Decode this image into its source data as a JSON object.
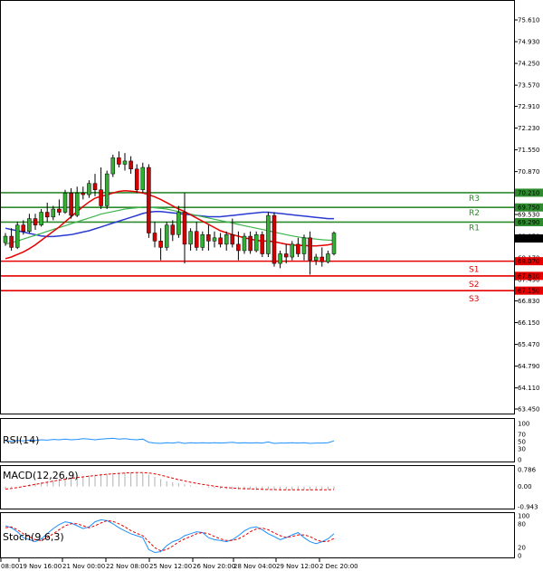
{
  "chart_data": [
    {
      "type": "candlestick",
      "ylim": [
        63.45,
        76.1
      ],
      "yticks": [
        "75.610",
        "74.930",
        "74.250",
        "73.570",
        "72.910",
        "72.230",
        "71.550",
        "70.870",
        "70.190",
        "69.530",
        "68.850",
        "68.170",
        "67.490",
        "66.830",
        "66.150",
        "65.470",
        "64.790",
        "64.110",
        "63.450"
      ],
      "xticks": [
        "08:00",
        "19 Nov 16:00",
        "21 Nov 00:00",
        "22 Nov 08:00",
        "25 Nov 12:00",
        "26 Nov 20:00",
        "28 Nov 04:00",
        "29 Nov 12:00",
        "2 Dec 20:00"
      ],
      "levels": [
        {
          "name": "R3",
          "value": 70.21,
          "label": "70.210"
        },
        {
          "name": "R2",
          "value": 69.75,
          "label": "69.750"
        },
        {
          "name": "R1",
          "value": 69.29,
          "label": "69.290"
        },
        {
          "name": "S1",
          "value": 68.07,
          "label": "68.070"
        },
        {
          "name": "S2",
          "value": 67.61,
          "label": "67.610"
        },
        {
          "name": "S3",
          "value": 67.15,
          "label": "67.150"
        }
      ],
      "current_price": {
        "value": 68.78,
        "label": "68.780"
      },
      "candles": [
        [
          68.65,
          68.95,
          68.55,
          68.85
        ],
        [
          68.85,
          69.1,
          68.4,
          68.5
        ],
        [
          68.5,
          69.3,
          68.45,
          69.2
        ],
        [
          69.2,
          69.35,
          68.9,
          69.0
        ],
        [
          69.0,
          69.55,
          68.95,
          69.4
        ],
        [
          69.4,
          69.55,
          69.05,
          69.2
        ],
        [
          69.2,
          69.7,
          69.15,
          69.6
        ],
        [
          69.6,
          69.9,
          69.3,
          69.45
        ],
        [
          69.45,
          69.8,
          69.35,
          69.7
        ],
        [
          69.7,
          70.0,
          69.5,
          69.6
        ],
        [
          69.6,
          70.3,
          69.55,
          70.2
        ],
        [
          70.2,
          70.35,
          69.4,
          69.5
        ],
        [
          69.5,
          70.4,
          69.45,
          70.2
        ],
        [
          70.2,
          70.4,
          70.0,
          70.15
        ],
        [
          70.15,
          70.6,
          70.05,
          70.5
        ],
        [
          70.5,
          70.8,
          70.1,
          70.3
        ],
        [
          70.3,
          71.0,
          69.7,
          69.8
        ],
        [
          69.8,
          70.9,
          69.7,
          70.8
        ],
        [
          70.8,
          71.4,
          70.7,
          71.3
        ],
        [
          71.3,
          71.5,
          71.0,
          71.1
        ],
        [
          71.1,
          71.45,
          70.9,
          71.2
        ],
        [
          71.2,
          71.35,
          70.8,
          70.95
        ],
        [
          70.95,
          71.1,
          70.2,
          70.3
        ],
        [
          70.3,
          71.15,
          70.2,
          71.0
        ],
        [
          71.0,
          71.1,
          68.8,
          68.95
        ],
        [
          68.95,
          69.3,
          68.5,
          68.7
        ],
        [
          68.7,
          69.1,
          68.1,
          68.5
        ],
        [
          68.5,
          69.3,
          68.4,
          69.2
        ],
        [
          69.2,
          69.35,
          68.7,
          68.9
        ],
        [
          68.9,
          69.8,
          68.8,
          69.6
        ],
        [
          69.6,
          70.2,
          68.0,
          68.6
        ],
        [
          68.6,
          69.1,
          68.4,
          69.0
        ],
        [
          69.0,
          69.3,
          68.4,
          68.5
        ],
        [
          68.5,
          69.0,
          68.4,
          68.9
        ],
        [
          68.9,
          69.2,
          68.4,
          68.7
        ],
        [
          68.7,
          69.0,
          68.5,
          68.8
        ],
        [
          68.8,
          68.95,
          68.5,
          68.6
        ],
        [
          68.6,
          69.0,
          68.4,
          68.9
        ],
        [
          68.9,
          69.4,
          68.5,
          68.6
        ],
        [
          68.6,
          69.0,
          68.1,
          68.4
        ],
        [
          68.4,
          68.95,
          68.3,
          68.85
        ],
        [
          68.85,
          69.0,
          68.3,
          68.4
        ],
        [
          68.4,
          69.0,
          68.35,
          68.9
        ],
        [
          68.9,
          69.0,
          68.2,
          68.3
        ],
        [
          68.3,
          69.6,
          68.2,
          69.5
        ],
        [
          69.5,
          69.6,
          67.9,
          68.0
        ],
        [
          68.0,
          68.4,
          67.85,
          68.3
        ],
        [
          68.3,
          68.6,
          68.0,
          68.2
        ],
        [
          68.2,
          68.7,
          68.1,
          68.6
        ],
        [
          68.6,
          68.8,
          68.2,
          68.3
        ],
        [
          68.3,
          68.9,
          68.1,
          68.8
        ],
        [
          68.8,
          69.0,
          67.65,
          68.1
        ],
        [
          68.1,
          68.3,
          67.95,
          68.2
        ],
        [
          68.2,
          68.5,
          67.9,
          68.05
        ],
        [
          68.05,
          68.4,
          68.0,
          68.3
        ],
        [
          68.3,
          69.0,
          68.25,
          68.95
        ]
      ],
      "ma_fast": [
        68.15,
        68.2,
        68.28,
        68.36,
        68.46,
        68.58,
        68.72,
        68.86,
        69.0,
        69.14,
        69.3,
        69.46,
        69.62,
        69.78,
        69.92,
        70.04,
        70.1,
        70.14,
        70.2,
        70.25,
        70.27,
        70.26,
        70.24,
        70.2,
        70.15,
        70.08,
        70.0,
        69.9,
        69.8,
        69.7,
        69.62,
        69.52,
        69.42,
        69.32,
        69.22,
        69.12,
        69.02,
        68.96,
        68.9,
        68.85,
        68.8,
        68.76,
        68.72,
        68.7,
        68.7,
        68.68,
        68.64,
        68.6,
        68.58,
        68.56,
        68.56,
        68.55,
        68.55,
        68.56,
        68.58,
        68.62
      ],
      "ma_mid": [
        68.6,
        68.65,
        68.7,
        68.76,
        68.82,
        68.88,
        68.94,
        69.0,
        69.06,
        69.12,
        69.18,
        69.24,
        69.3,
        69.36,
        69.42,
        69.48,
        69.54,
        69.58,
        69.62,
        69.66,
        69.7,
        69.72,
        69.74,
        69.76,
        69.76,
        69.74,
        69.72,
        69.7,
        69.66,
        69.62,
        69.58,
        69.54,
        69.5,
        69.46,
        69.42,
        69.38,
        69.34,
        69.3,
        69.26,
        69.22,
        69.18,
        69.14,
        69.1,
        69.06,
        69.02,
        68.98,
        68.94,
        68.9,
        68.86,
        68.83,
        68.8,
        68.78,
        68.76,
        68.74,
        68.73,
        68.72
      ],
      "ma_slow": [
        69.1,
        69.06,
        69.02,
        68.98,
        68.94,
        68.9,
        68.86,
        68.84,
        68.84,
        68.86,
        68.88,
        68.9,
        68.94,
        68.98,
        69.02,
        69.08,
        69.14,
        69.2,
        69.26,
        69.32,
        69.38,
        69.44,
        69.5,
        69.56,
        69.6,
        69.62,
        69.62,
        69.6,
        69.58,
        69.56,
        69.54,
        69.52,
        69.5,
        69.48,
        69.46,
        69.46,
        69.46,
        69.48,
        69.5,
        69.52,
        69.54,
        69.56,
        69.58,
        69.6,
        69.6,
        69.58,
        69.56,
        69.54,
        69.52,
        69.5,
        69.48,
        69.46,
        69.44,
        69.42,
        69.4,
        69.4
      ]
    },
    {
      "type": "line",
      "title": "RSI(14)",
      "ylim": [
        0,
        100
      ],
      "yticks": [
        "100",
        "70",
        "50",
        "30",
        "0"
      ],
      "series": [
        {
          "values": [
            52,
            51,
            53,
            52,
            54,
            53,
            55,
            54,
            56,
            55,
            57,
            55,
            56,
            58,
            57,
            55,
            57,
            58,
            59,
            57,
            58,
            56,
            55,
            57,
            48,
            46,
            45,
            47,
            46,
            48,
            45,
            47,
            46,
            47,
            46,
            47,
            46,
            47,
            48,
            46,
            47,
            46,
            47,
            46,
            49,
            45,
            46,
            46,
            47,
            46,
            47,
            45,
            46,
            46,
            47,
            52
          ]
        }
      ]
    },
    {
      "type": "bar+line",
      "title": "MACD(12,26,9)",
      "ylim": [
        -0.943,
        0.786
      ],
      "yticks": [
        "0.786",
        "0.00",
        "-0.943"
      ],
      "histogram": [
        -0.1,
        -0.05,
        0.0,
        0.05,
        0.1,
        0.15,
        0.2,
        0.25,
        0.3,
        0.35,
        0.4,
        0.42,
        0.45,
        0.48,
        0.52,
        0.55,
        0.58,
        0.6,
        0.62,
        0.65,
        0.66,
        0.67,
        0.66,
        0.64,
        0.55,
        0.45,
        0.35,
        0.25,
        0.2,
        0.15,
        0.1,
        0.05,
        0.02,
        -0.02,
        -0.05,
        -0.08,
        -0.1,
        -0.12,
        -0.13,
        -0.14,
        -0.15,
        -0.15,
        -0.16,
        -0.16,
        -0.15,
        -0.17,
        -0.17,
        -0.17,
        -0.16,
        -0.16,
        -0.15,
        -0.16,
        -0.15,
        -0.15,
        -0.14,
        -0.12
      ],
      "signal": [
        -0.12,
        -0.09,
        -0.05,
        0.0,
        0.05,
        0.1,
        0.15,
        0.2,
        0.25,
        0.3,
        0.34,
        0.38,
        0.42,
        0.45,
        0.48,
        0.51,
        0.54,
        0.57,
        0.59,
        0.61,
        0.63,
        0.64,
        0.65,
        0.65,
        0.63,
        0.59,
        0.53,
        0.46,
        0.39,
        0.32,
        0.26,
        0.2,
        0.15,
        0.1,
        0.06,
        0.02,
        -0.02,
        -0.05,
        -0.07,
        -0.09,
        -0.1,
        -0.11,
        -0.12,
        -0.13,
        -0.14,
        -0.14,
        -0.15,
        -0.15,
        -0.15,
        -0.15,
        -0.15,
        -0.15,
        -0.15,
        -0.15,
        -0.15,
        -0.14
      ]
    },
    {
      "type": "line",
      "title": "Stoch(9,6,3)",
      "ylim": [
        0,
        100
      ],
      "yticks": [
        "100",
        "80",
        "20",
        "0"
      ],
      "series": [
        {
          "values": [
            75,
            70,
            60,
            45,
            40,
            35,
            42,
            55,
            68,
            78,
            85,
            82,
            75,
            68,
            72,
            85,
            90,
            88,
            80,
            70,
            62,
            55,
            50,
            45,
            15,
            8,
            10,
            25,
            35,
            40,
            50,
            55,
            60,
            58,
            45,
            40,
            38,
            35,
            40,
            50,
            62,
            70,
            72,
            65,
            55,
            48,
            40,
            45,
            52,
            58,
            45,
            35,
            30,
            35,
            42,
            55
          ]
        },
        {
          "values": [
            70,
            72,
            65,
            55,
            48,
            40,
            38,
            45,
            55,
            65,
            75,
            80,
            80,
            75,
            70,
            75,
            82,
            88,
            86,
            80,
            72,
            63,
            56,
            50,
            35,
            20,
            12,
            15,
            24,
            34,
            42,
            48,
            55,
            58,
            55,
            48,
            42,
            38,
            38,
            42,
            50,
            60,
            67,
            69,
            65,
            57,
            50,
            46,
            48,
            52,
            52,
            48,
            40,
            35,
            36,
            43
          ]
        }
      ]
    }
  ]
}
